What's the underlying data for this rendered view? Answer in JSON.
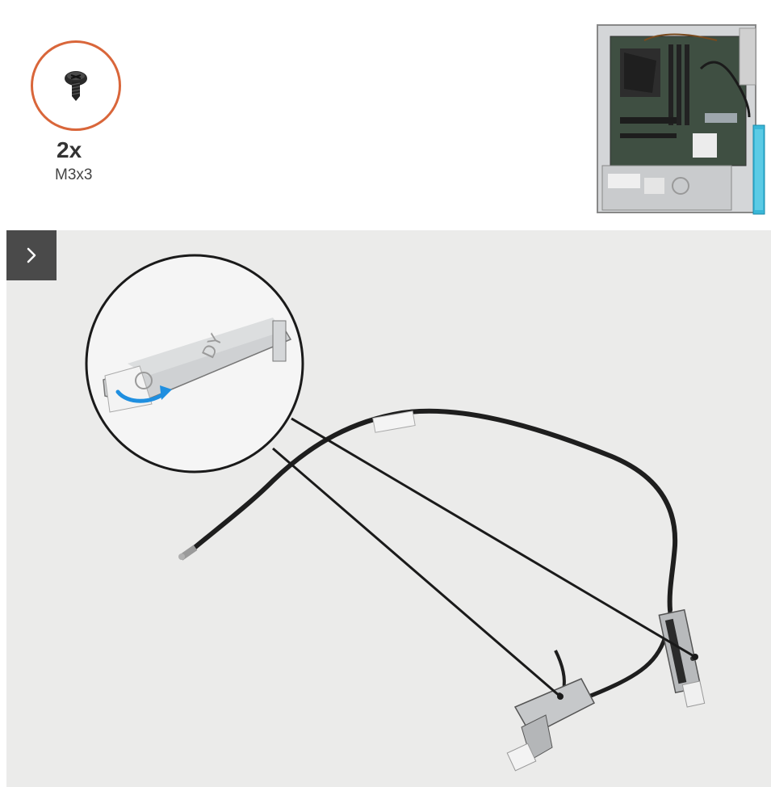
{
  "screw": {
    "quantity": "2x",
    "size": "M3x3",
    "ring_color": "#d9663a"
  },
  "icons": {
    "screw": "screw-icon",
    "next": "chevron-right-icon"
  },
  "colors": {
    "panel_background": "#ebebea",
    "cable": "#1e1e1e",
    "rotation_arrow": "#1f8fe0"
  }
}
